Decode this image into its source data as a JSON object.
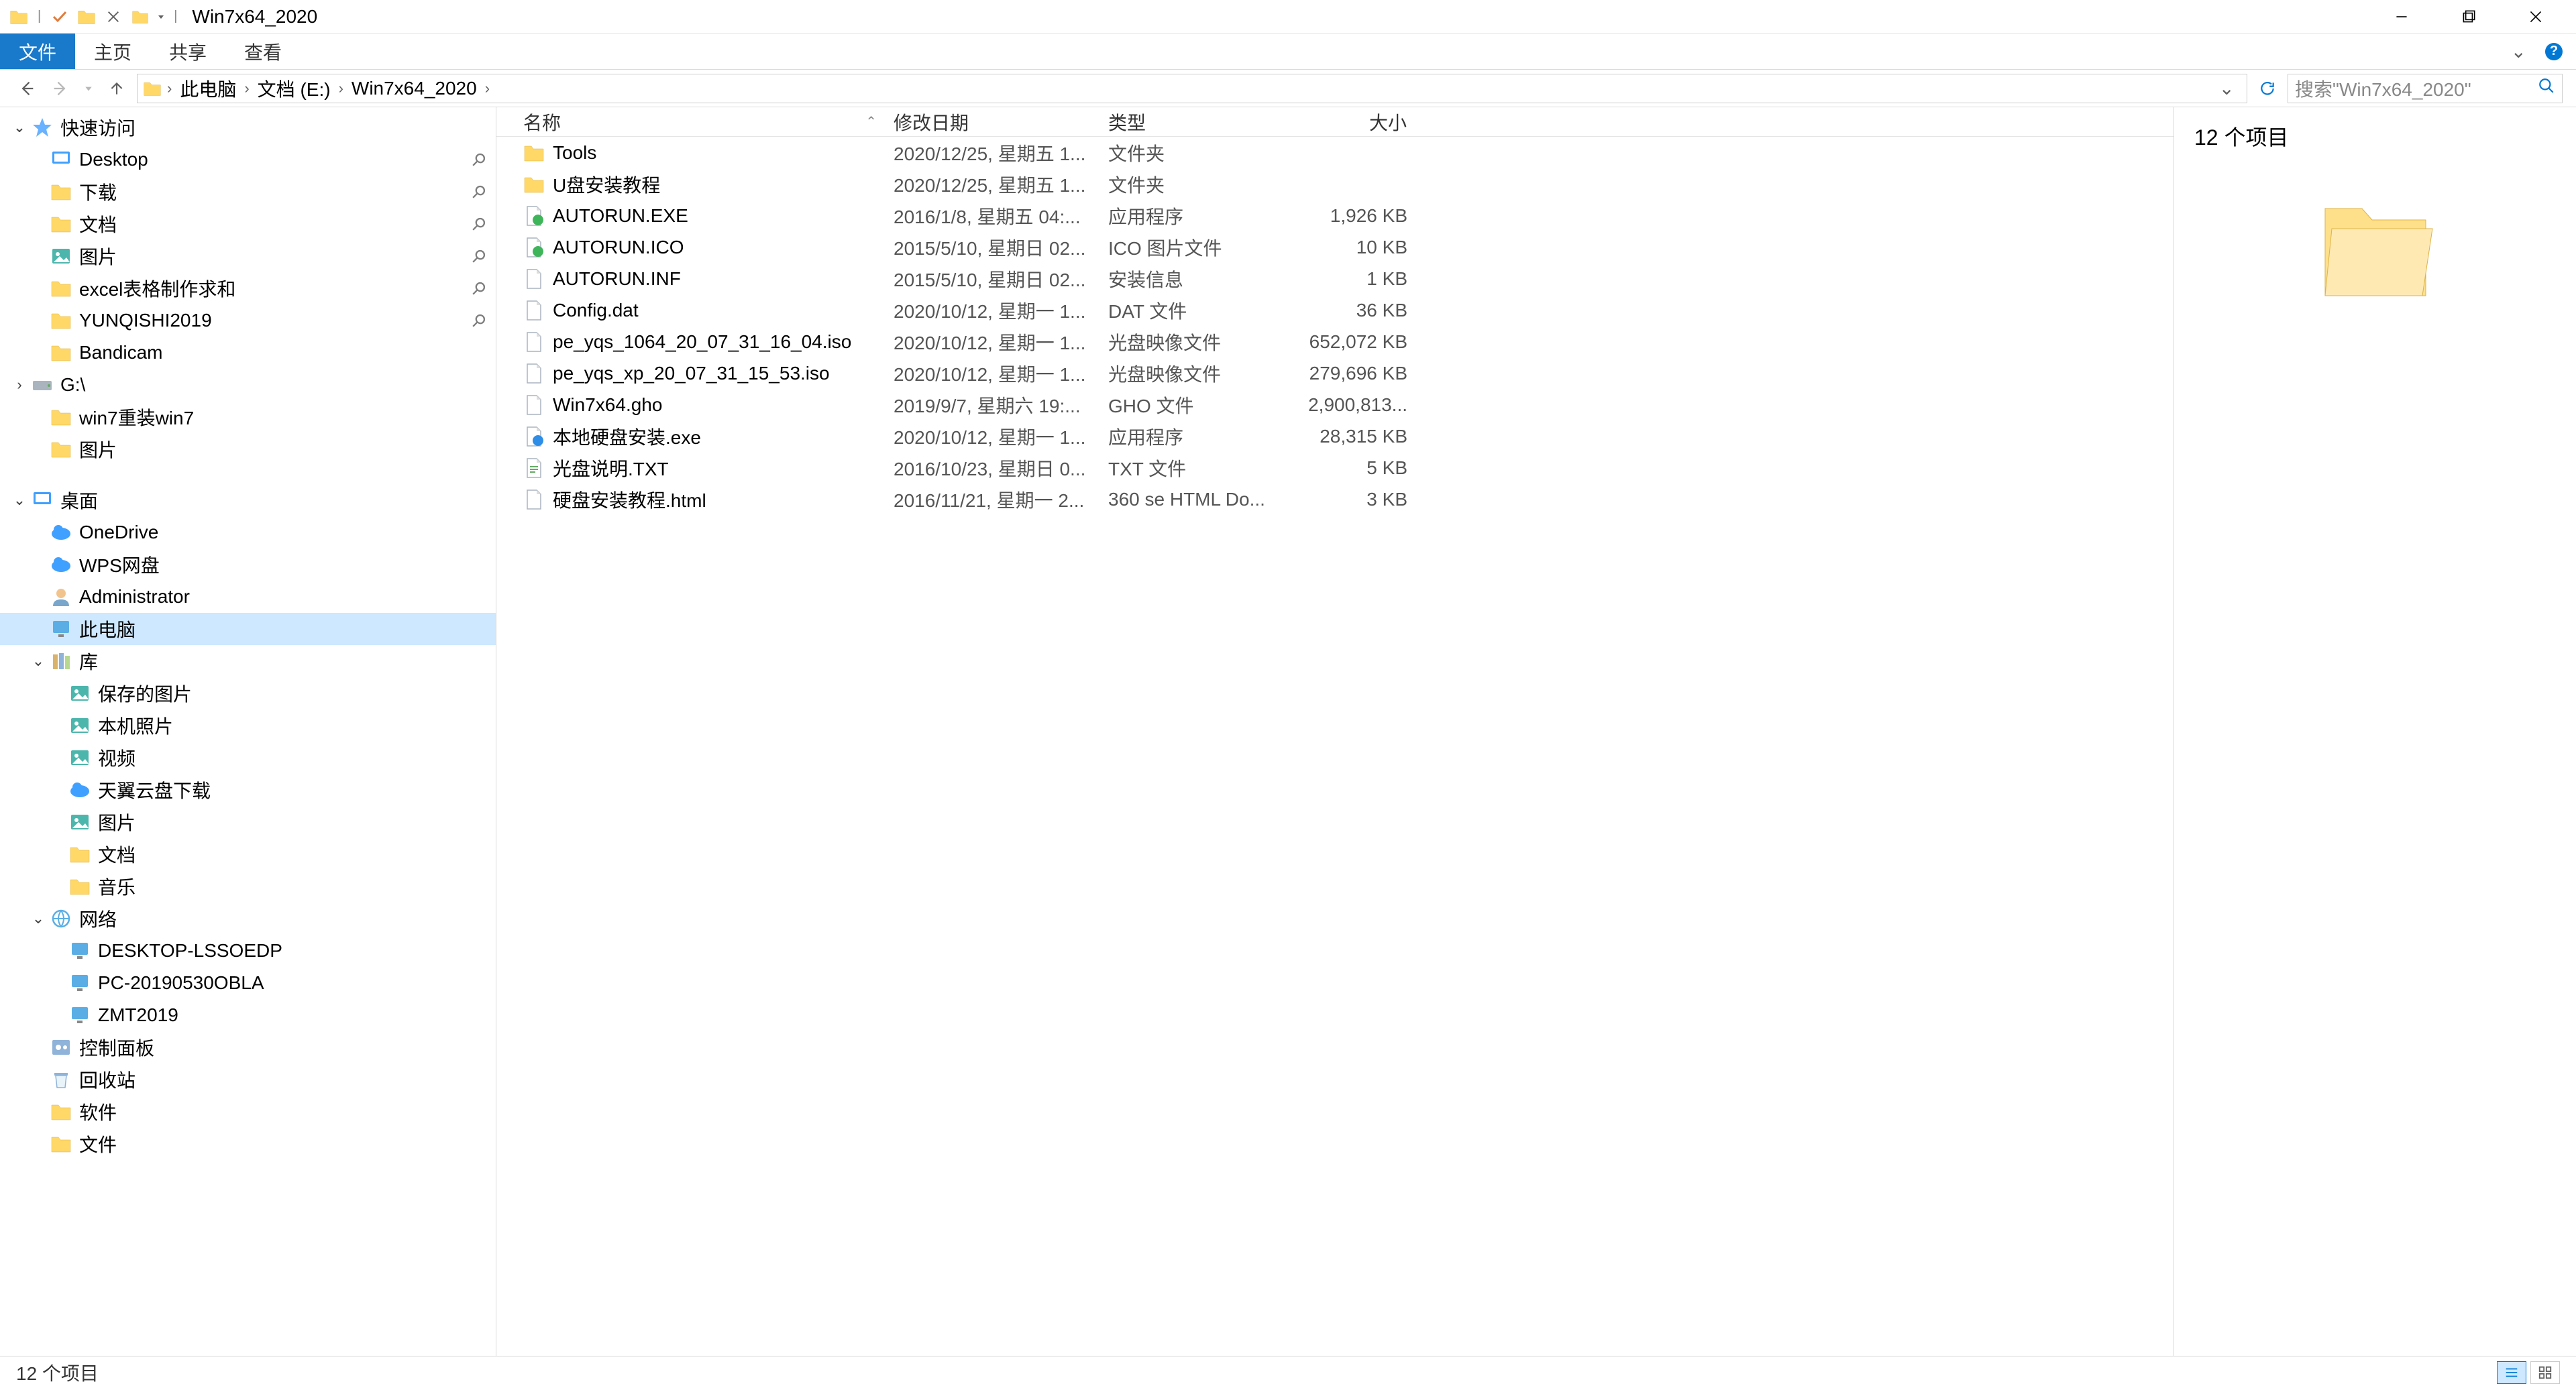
{
  "window": {
    "title": "Win7x64_2020"
  },
  "ribbon": {
    "tabs": [
      "文件",
      "主页",
      "共享",
      "查看"
    ]
  },
  "breadcrumbs": [
    "此电脑",
    "文档 (E:)",
    "Win7x64_2020"
  ],
  "search": {
    "placeholder": "搜索\"Win7x64_2020\""
  },
  "sidebar": {
    "groups": [
      {
        "label": "快速访问",
        "icon": "star",
        "indent": 1,
        "expand": "v"
      },
      {
        "label": "Desktop",
        "icon": "desktop",
        "indent": 2,
        "pin": true
      },
      {
        "label": "下载",
        "icon": "downloads",
        "indent": 2,
        "pin": true
      },
      {
        "label": "文档",
        "icon": "documents",
        "indent": 2,
        "pin": true
      },
      {
        "label": "图片",
        "icon": "pictures",
        "indent": 2,
        "pin": true
      },
      {
        "label": "excel表格制作求和",
        "icon": "folder",
        "indent": 2,
        "pin": true
      },
      {
        "label": "YUNQISHI2019",
        "icon": "folder",
        "indent": 2,
        "pin": true
      },
      {
        "label": "Bandicam",
        "icon": "folder",
        "indent": 2
      },
      {
        "label": "G:\\",
        "icon": "drive",
        "indent": 1,
        "expand": ">"
      },
      {
        "label": "win7重装win7",
        "icon": "folder",
        "indent": 2
      },
      {
        "label": "图片",
        "icon": "folder",
        "indent": 2
      },
      {
        "label": "桌面",
        "icon": "desktop-root",
        "indent": 1,
        "expand": "v",
        "spacer": true
      },
      {
        "label": "OneDrive",
        "icon": "cloud",
        "indent": 2
      },
      {
        "label": "WPS网盘",
        "icon": "wps",
        "indent": 2
      },
      {
        "label": "Administrator",
        "icon": "user",
        "indent": 2
      },
      {
        "label": "此电脑",
        "icon": "pc",
        "indent": 2,
        "selected": true
      },
      {
        "label": "库",
        "icon": "library",
        "indent": 2,
        "expand": "v"
      },
      {
        "label": "保存的图片",
        "icon": "pic",
        "indent": 3
      },
      {
        "label": "本机照片",
        "icon": "pic",
        "indent": 3
      },
      {
        "label": "视频",
        "icon": "video",
        "indent": 3
      },
      {
        "label": "天翼云盘下载",
        "icon": "cloud2",
        "indent": 3
      },
      {
        "label": "图片",
        "icon": "pic",
        "indent": 3
      },
      {
        "label": "文档",
        "icon": "documents",
        "indent": 3
      },
      {
        "label": "音乐",
        "icon": "music",
        "indent": 3
      },
      {
        "label": "网络",
        "icon": "network",
        "indent": 2,
        "expand": "v"
      },
      {
        "label": "DESKTOP-LSSOEDP",
        "icon": "pc",
        "indent": 3
      },
      {
        "label": "PC-20190530OBLA",
        "icon": "pc",
        "indent": 3
      },
      {
        "label": "ZMT2019",
        "icon": "pc",
        "indent": 3
      },
      {
        "label": "控制面板",
        "icon": "control",
        "indent": 2
      },
      {
        "label": "回收站",
        "icon": "recycle",
        "indent": 2
      },
      {
        "label": "软件",
        "icon": "folder",
        "indent": 2
      },
      {
        "label": "文件",
        "icon": "folder",
        "indent": 2
      }
    ]
  },
  "columns": {
    "name": "名称",
    "date": "修改日期",
    "type": "类型",
    "size": "大小"
  },
  "files": [
    {
      "name": "Tools",
      "date": "2020/12/25, 星期五 1...",
      "type": "文件夹",
      "size": "",
      "icon": "folder"
    },
    {
      "name": "U盘安装教程",
      "date": "2020/12/25, 星期五 1...",
      "type": "文件夹",
      "size": "",
      "icon": "folder"
    },
    {
      "name": "AUTORUN.EXE",
      "date": "2016/1/8, 星期五 04:...",
      "type": "应用程序",
      "size": "1,926 KB",
      "icon": "exe-green"
    },
    {
      "name": "AUTORUN.ICO",
      "date": "2015/5/10, 星期日 02...",
      "type": "ICO 图片文件",
      "size": "10 KB",
      "icon": "exe-green"
    },
    {
      "name": "AUTORUN.INF",
      "date": "2015/5/10, 星期日 02...",
      "type": "安装信息",
      "size": "1 KB",
      "icon": "inf"
    },
    {
      "name": "Config.dat",
      "date": "2020/10/12, 星期一 1...",
      "type": "DAT 文件",
      "size": "36 KB",
      "icon": "file"
    },
    {
      "name": "pe_yqs_1064_20_07_31_16_04.iso",
      "date": "2020/10/12, 星期一 1...",
      "type": "光盘映像文件",
      "size": "652,072 KB",
      "icon": "iso"
    },
    {
      "name": "pe_yqs_xp_20_07_31_15_53.iso",
      "date": "2020/10/12, 星期一 1...",
      "type": "光盘映像文件",
      "size": "279,696 KB",
      "icon": "iso"
    },
    {
      "name": "Win7x64.gho",
      "date": "2019/9/7, 星期六 19:...",
      "type": "GHO 文件",
      "size": "2,900,813...",
      "icon": "file"
    },
    {
      "name": "本地硬盘安装.exe",
      "date": "2020/10/12, 星期一 1...",
      "type": "应用程序",
      "size": "28,315 KB",
      "icon": "exe-blue"
    },
    {
      "name": "光盘说明.TXT",
      "date": "2016/10/23, 星期日 0...",
      "type": "TXT 文件",
      "size": "5 KB",
      "icon": "txt"
    },
    {
      "name": "硬盘安装教程.html",
      "date": "2016/11/21, 星期一 2...",
      "type": "360 se HTML Do...",
      "size": "3 KB",
      "icon": "html"
    }
  ],
  "details": {
    "title": "12 个项目"
  },
  "status": {
    "text": "12 个项目"
  }
}
